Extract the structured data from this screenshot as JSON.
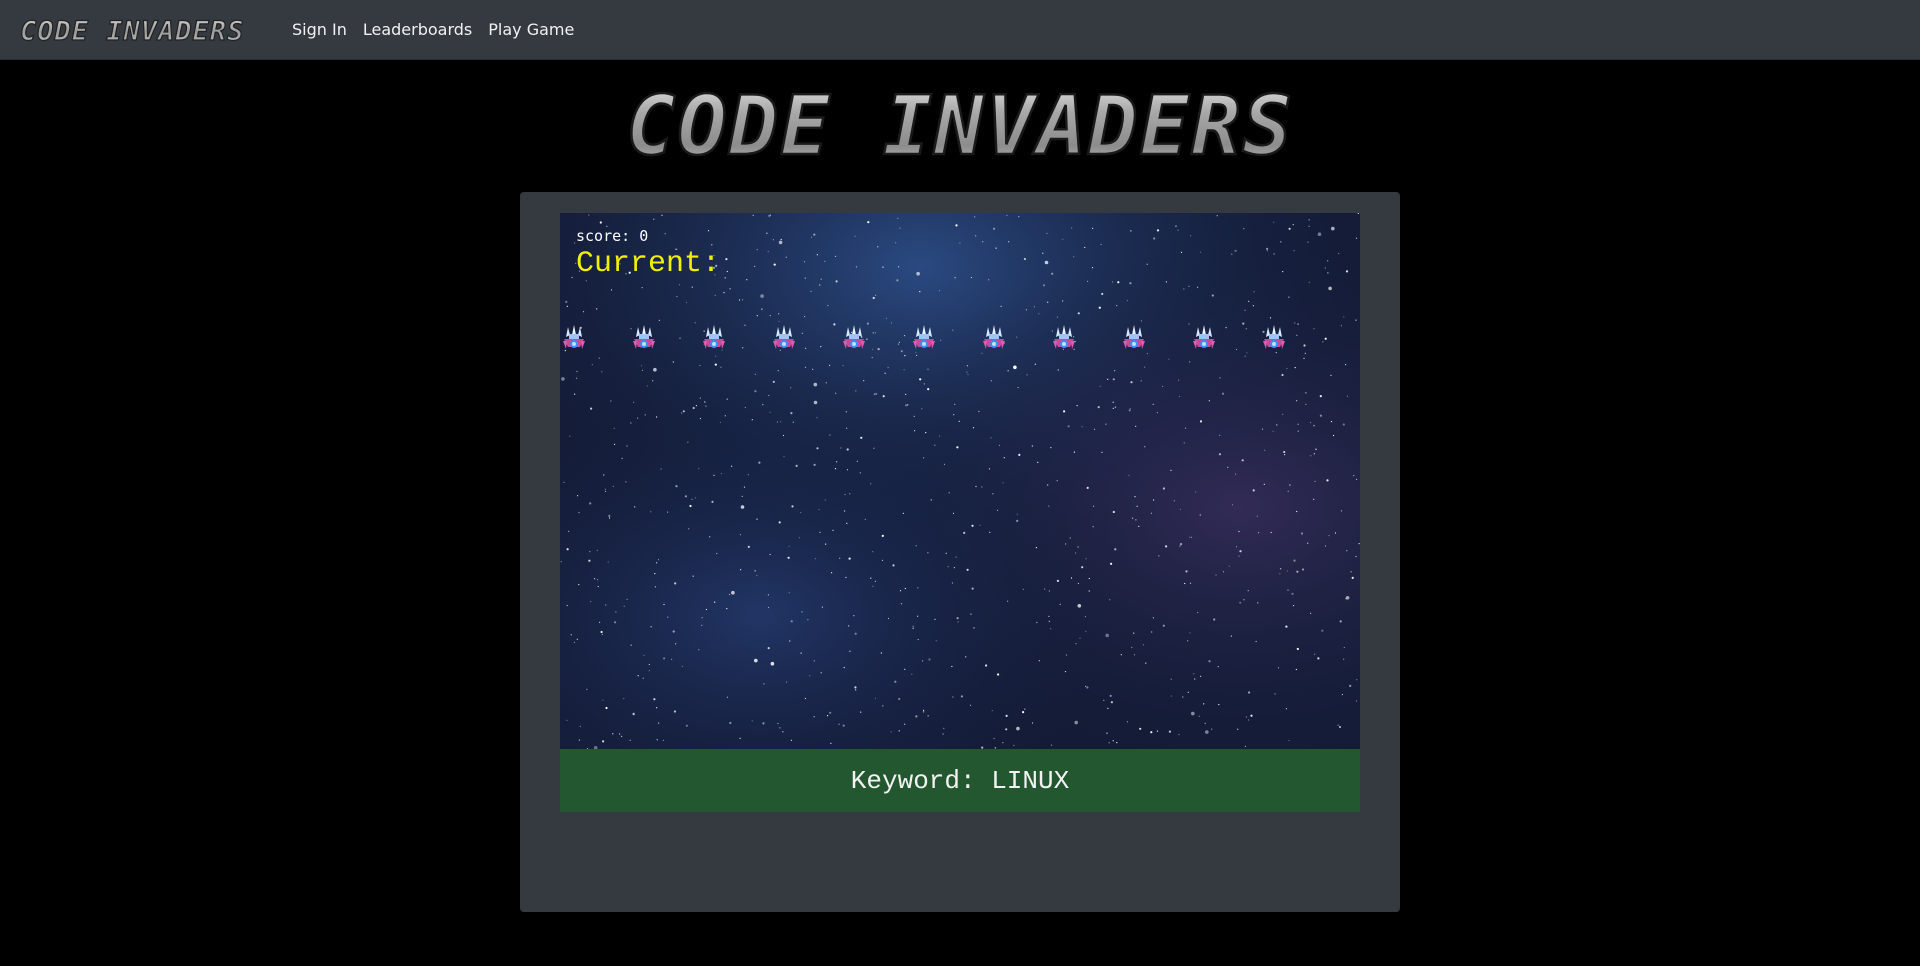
{
  "navbar": {
    "brand": "CODE INVADERS",
    "links": [
      "Sign In",
      "Leaderboards",
      "Play Game"
    ]
  },
  "hero": {
    "title": "CODE INVADERS"
  },
  "game": {
    "score_label": "score: 0",
    "current_label": "Current:",
    "current_value": "",
    "invader_count": 11,
    "keyword_label": "Keyword: LINUX"
  },
  "colors": {
    "navbar_bg": "#343a40",
    "panel_bg": "#343a40",
    "keyword_bg": "#225730",
    "current_text": "#f0f000"
  }
}
